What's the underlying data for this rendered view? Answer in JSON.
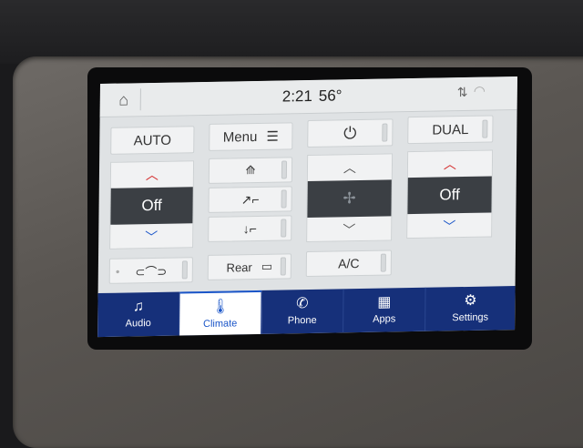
{
  "status_bar": {
    "time": "2:21",
    "outside_temp": "56°",
    "icons": [
      "home-icon",
      "sync-arrows-icon",
      "wifi-icon"
    ]
  },
  "climate": {
    "auto_label": "AUTO",
    "menu_label": "Menu",
    "dual_label": "DUAL",
    "driver_temp": "Off",
    "passenger_temp": "Off",
    "rear_label": "Rear",
    "ac_label": "A/C"
  },
  "nav": {
    "items": [
      {
        "label": "Audio",
        "icon": "music-note-icon"
      },
      {
        "label": "Climate",
        "icon": "thermometer-icon"
      },
      {
        "label": "Phone",
        "icon": "phone-icon"
      },
      {
        "label": "Apps",
        "icon": "apps-grid-icon"
      },
      {
        "label": "Settings",
        "icon": "gears-icon"
      }
    ],
    "active_index": 1
  },
  "colors": {
    "nav_bg": "#16307a",
    "accent_blue": "#1a55c8",
    "arrow_red": "#d42a2a",
    "temp_display_bg": "#3b3f44"
  }
}
